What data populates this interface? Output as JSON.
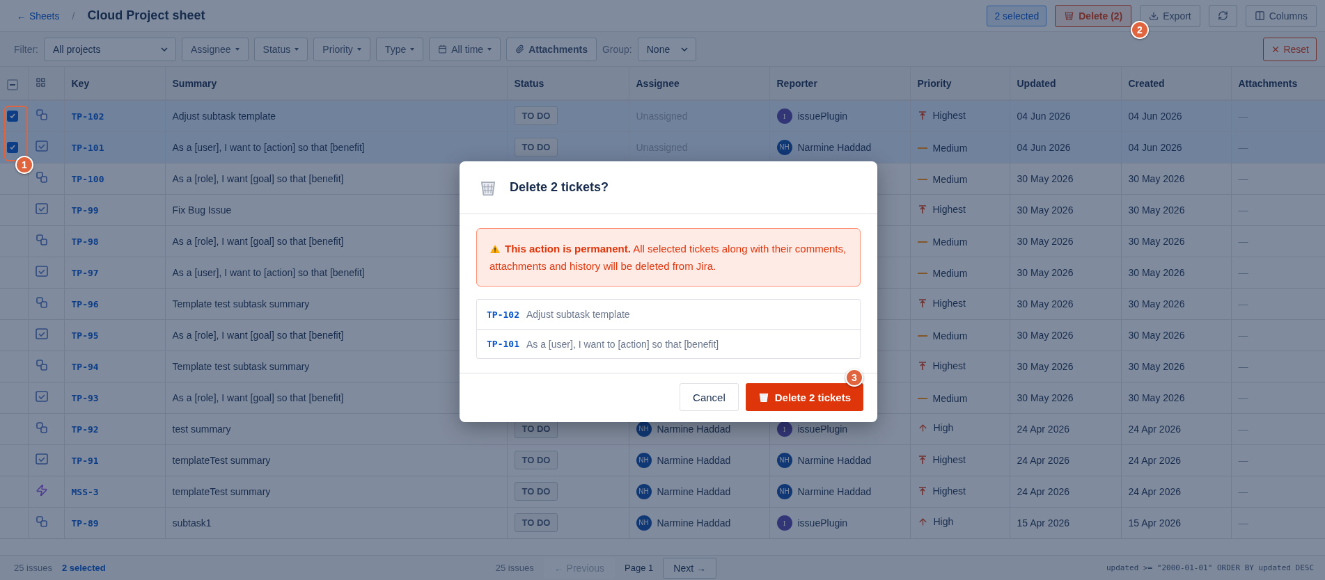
{
  "topbar": {
    "back_link": "← Sheets",
    "separator": "/",
    "title": "Cloud Project sheet",
    "selected_badge": "2 selected",
    "actions": [
      {
        "kind": "delete",
        "label": "Delete (2)"
      },
      {
        "kind": "export",
        "label": "Export"
      },
      {
        "kind": "refresh"
      },
      {
        "kind": "columns",
        "label": "Columns"
      }
    ]
  },
  "filters": {
    "label": "Filter:",
    "project": "All projects",
    "dropdowns": [
      {
        "kind": "plain",
        "label": "Assignee"
      },
      {
        "kind": "plain",
        "label": "Status"
      },
      {
        "kind": "plain",
        "label": "Priority"
      },
      {
        "kind": "plain",
        "label": "Type"
      },
      {
        "kind": "date",
        "label": "All time"
      }
    ],
    "attachments": "Attachments",
    "group_label": "Group:",
    "group": "None",
    "reset": "Reset"
  },
  "table": {
    "select_all_indeterminate": true,
    "columns": [
      "Key",
      "Summary",
      "Status",
      "Assignee",
      "Reporter",
      "Priority",
      "Updated",
      "Created",
      "Attachments"
    ],
    "rows": [
      {
        "selected": true,
        "kind": "subtask",
        "key": "TP-102",
        "summary": "Adjust subtask template",
        "status": "TO DO",
        "assignee": {
          "kind": "none",
          "name": "Unassigned"
        },
        "reporter": {
          "kind": "bot",
          "initials": "I",
          "name": "issuePlugin"
        },
        "priority": {
          "kind": "highest",
          "label": "Highest"
        },
        "updated": "04 Jun 2026",
        "created": "04 Jun 2026",
        "attachments": "—"
      },
      {
        "selected": true,
        "kind": "task",
        "key": "TP-101",
        "summary": "As a [user], I want to [action] so that [benefit]",
        "status": "TO DO",
        "assignee": {
          "kind": "none",
          "name": "Unassigned"
        },
        "reporter": {
          "kind": "user",
          "initials": "NH",
          "name": "Narmine Haddad"
        },
        "priority": {
          "kind": "medium",
          "label": "Medium"
        },
        "updated": "04 Jun 2026",
        "created": "04 Jun 2026",
        "attachments": "—"
      },
      {
        "selected": false,
        "kind": "subtask",
        "key": "TP-100",
        "summary": "As a [role], I want [goal] so that [benefit]",
        "priority": {
          "kind": "medium",
          "label": "Medium"
        },
        "updated": "30 May 2026",
        "created": "30 May 2026",
        "attachments": "—"
      },
      {
        "selected": false,
        "kind": "task",
        "key": "TP-99",
        "summary": "Fix Bug Issue",
        "priority": {
          "kind": "highest",
          "label": "Highest"
        },
        "updated": "30 May 2026",
        "created": "30 May 2026",
        "attachments": "—"
      },
      {
        "selected": false,
        "kind": "subtask",
        "key": "TP-98",
        "summary": "As a [role], I want [goal] so that [benefit]",
        "priority": {
          "kind": "medium",
          "label": "Medium"
        },
        "updated": "30 May 2026",
        "created": "30 May 2026",
        "attachments": "—"
      },
      {
        "selected": false,
        "kind": "task",
        "key": "TP-97",
        "summary": "As a [user], I want to [action] so that [benefit]",
        "priority": {
          "kind": "medium",
          "label": "Medium"
        },
        "updated": "30 May 2026",
        "created": "30 May 2026",
        "attachments": "—"
      },
      {
        "selected": false,
        "kind": "subtask",
        "key": "TP-96",
        "summary": "Template test subtask summary",
        "priority": {
          "kind": "highest",
          "label": "Highest"
        },
        "updated": "30 May 2026",
        "created": "30 May 2026",
        "attachments": "—"
      },
      {
        "selected": false,
        "kind": "task",
        "key": "TP-95",
        "summary": "As a [role], I want [goal] so that [benefit]",
        "priority": {
          "kind": "medium",
          "label": "Medium"
        },
        "updated": "30 May 2026",
        "created": "30 May 2026",
        "attachments": "—"
      },
      {
        "selected": false,
        "kind": "subtask",
        "key": "TP-94",
        "summary": "Template test subtask summary",
        "priority": {
          "kind": "highest",
          "label": "Highest"
        },
        "updated": "30 May 2026",
        "created": "30 May 2026",
        "attachments": "—"
      },
      {
        "selected": false,
        "kind": "task",
        "key": "TP-93",
        "summary": "As a [role], I want [goal] so that [benefit]",
        "priority": {
          "kind": "medium",
          "label": "Medium"
        },
        "updated": "30 May 2026",
        "created": "30 May 2026",
        "attachments": "—"
      },
      {
        "selected": false,
        "kind": "subtask",
        "key": "TP-92",
        "summary": "test summary",
        "status": "TO DO",
        "assignee": {
          "kind": "user",
          "initials": "NH",
          "name": "Narmine Haddad"
        },
        "reporter": {
          "kind": "bot",
          "initials": "I",
          "name": "issuePlugin"
        },
        "priority": {
          "kind": "high",
          "label": "High"
        },
        "updated": "24 Apr 2026",
        "created": "24 Apr 2026",
        "attachments": "—"
      },
      {
        "selected": false,
        "kind": "task",
        "key": "TP-91",
        "summary": "templateTest summary",
        "status": "TO DO",
        "assignee": {
          "kind": "user",
          "initials": "NH",
          "name": "Narmine Haddad"
        },
        "reporter": {
          "kind": "user",
          "initials": "NH",
          "name": "Narmine Haddad"
        },
        "priority": {
          "kind": "highest",
          "label": "Highest"
        },
        "updated": "24 Apr 2026",
        "created": "24 Apr 2026",
        "attachments": "—"
      },
      {
        "selected": false,
        "kind": "epic",
        "key": "MSS-3",
        "summary": "templateTest summary",
        "status": "TO DO",
        "assignee": {
          "kind": "user",
          "initials": "NH",
          "name": "Narmine Haddad"
        },
        "reporter": {
          "kind": "user",
          "initials": "NH",
          "name": "Narmine Haddad"
        },
        "priority": {
          "kind": "highest",
          "label": "Highest"
        },
        "updated": "24 Apr 2026",
        "created": "24 Apr 2026",
        "attachments": "—"
      },
      {
        "selected": false,
        "kind": "subtask",
        "key": "TP-89",
        "summary": "subtask1",
        "status": "TO DO",
        "assignee": {
          "kind": "user",
          "initials": "NH",
          "name": "Narmine Haddad"
        },
        "reporter": {
          "kind": "bot",
          "initials": "I",
          "name": "issuePlugin"
        },
        "priority": {
          "kind": "high",
          "label": "High"
        },
        "updated": "15 Apr 2026",
        "created": "15 Apr 2026",
        "attachments": "—"
      }
    ]
  },
  "footer": {
    "count": "25 issues",
    "selected": "2 selected",
    "center_count": "25 issues",
    "previous": {
      "label": "← Previous",
      "disabled": true
    },
    "page": "Page 1",
    "next": {
      "label": "Next →",
      "disabled": false
    },
    "query": "updated >= \"2000-01-01\" ORDER BY updated DESC"
  },
  "dialog": {
    "title": "Delete 2 tickets?",
    "warning": "**This action is permanent.** All selected tickets along with their comments, attachments and history will be deleted from Jira.",
    "items": [
      {
        "key": "TP-102",
        "summary": "Adjust subtask template"
      },
      {
        "key": "TP-101",
        "summary": "As a [user], I want to [action] so that [benefit]"
      }
    ],
    "cancel": "Cancel",
    "confirm": "Delete 2 tickets"
  },
  "annotations": [
    "1",
    "2",
    "3"
  ]
}
